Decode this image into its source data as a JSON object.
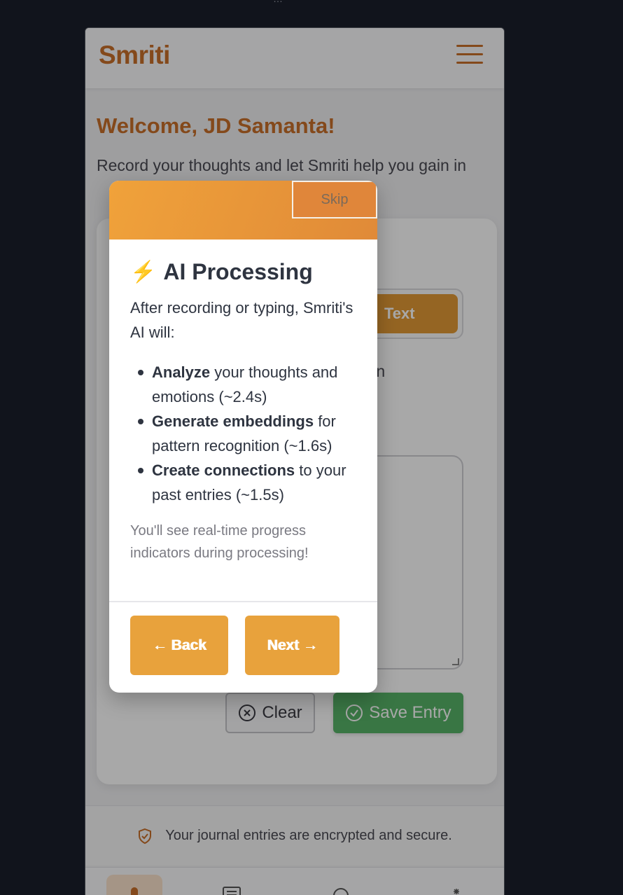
{
  "top_clip_text": "…",
  "header": {
    "title": "Smriti"
  },
  "welcome": {
    "heading": "Welcome, JD Samanta!",
    "subtitle": "Record your thoughts and let Smriti help you gain in"
  },
  "card": {
    "toggle_text_label": "Text",
    "prompt": "hare your es in",
    "clear_label": "Clear",
    "save_label": "Save Entry"
  },
  "footer": {
    "security_text": "Your journal entries are encrypted and secure."
  },
  "modal": {
    "skip_label": "Skip",
    "title": "AI Processing",
    "intro": "After recording or typing, Smriti's AI will:",
    "bullets": [
      {
        "bold": "Analyze",
        "rest": " your thoughts and emotions (~2.4s)"
      },
      {
        "bold": "Generate embeddings",
        "rest": " for pattern recognition (~1.6s)"
      },
      {
        "bold": "Create connections",
        "rest": " to your past entries (~1.5s)"
      }
    ],
    "note": "You'll see real-time progress indicators during processing!",
    "back_label": "← Back",
    "next_label": "Next →"
  },
  "colors": {
    "accent": "#c9702a",
    "button_orange": "#e8a23c",
    "save_green": "#57b368"
  },
  "icons": [
    "hamburger-icon",
    "bolt-icon",
    "clear-x-icon",
    "check-circle-icon",
    "shield-icon",
    "mic-icon",
    "list-icon",
    "search-icon",
    "sparkle-icon"
  ]
}
